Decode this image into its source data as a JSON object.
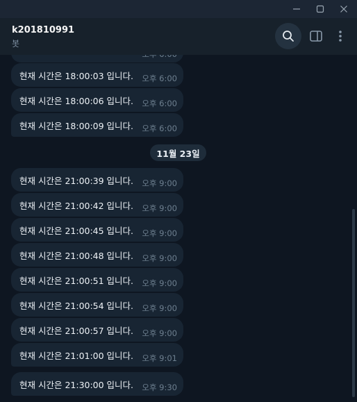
{
  "window": {
    "minimize_icon": "minimize-icon",
    "maximize_icon": "maximize-icon",
    "close_icon": "close-icon"
  },
  "header": {
    "title": "k201810991",
    "status": "봇",
    "icons": [
      "search-icon",
      "sidebar-toggle-icon",
      "more-vertical-icon"
    ]
  },
  "messages": [
    {
      "text": "현재 시간은 18:00:03 입니다.",
      "time": "오후 6:00"
    },
    {
      "text": "현재 시간은 18:00:06 입니다.",
      "time": "오후 6:00"
    },
    {
      "text": "현재 시간은 18:00:09 입니다.",
      "time": "오후 6:00"
    },
    {
      "text": "현재 시간은 21:00:39 입니다.",
      "time": "오후 9:00"
    },
    {
      "text": "현재 시간은 21:00:42 입니다.",
      "time": "오후 9:00"
    },
    {
      "text": "현재 시간은 21:00:45 입니다.",
      "time": "오후 9:00"
    },
    {
      "text": "현재 시간은 21:00:48 입니다.",
      "time": "오후 9:00"
    },
    {
      "text": "현재 시간은 21:00:51 입니다.",
      "time": "오후 9:00"
    },
    {
      "text": "현재 시간은 21:00:54 입니다.",
      "time": "오후 9:00"
    },
    {
      "text": "현재 시간은 21:00:57 입니다.",
      "time": "오후 9:00"
    },
    {
      "text": "현재 시간은 21:01:00 입니다.",
      "time": "오후 9:01"
    },
    {
      "text": "현재 시간은 21:30:00 입니다.",
      "time": "오후 9:30"
    }
  ],
  "date_separator": "11월 23일",
  "colors": {
    "background": "#0e1621",
    "header": "#17212b",
    "bubble": "#182533",
    "timestamp": "#6d7f8f"
  }
}
